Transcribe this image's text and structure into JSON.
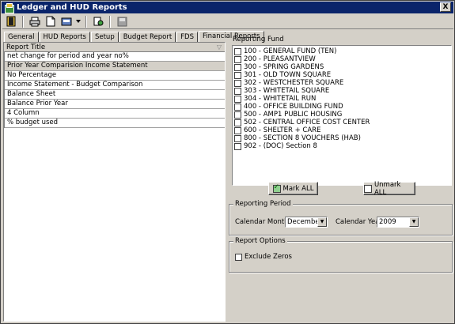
{
  "window": {
    "title": "Ledger and HUD Reports",
    "close_label": "X"
  },
  "toolbar": {
    "icons": [
      "exit-icon",
      "print-icon",
      "preview-icon",
      "export-icon",
      "dropdown-arrow-icon",
      "settings-icon",
      "save-icon"
    ]
  },
  "tabs": [
    {
      "label": "General",
      "active": false
    },
    {
      "label": "HUD Reports",
      "active": false
    },
    {
      "label": "Setup",
      "active": false
    },
    {
      "label": "Budget Report",
      "active": false
    },
    {
      "label": "FDS",
      "active": false
    },
    {
      "label": "Financial Reports",
      "active": true
    }
  ],
  "report_grid": {
    "header": "Report Title",
    "rows": [
      "net change for period and year no%",
      "Prior Year Comparision Income Statement",
      "No Percentage",
      "Income Statement - Budget Comparison",
      "Balance Sheet",
      "Balance Prior Year",
      "4 Column",
      "% budget used"
    ],
    "selected_index": 1
  },
  "reporting_fund": {
    "title": "Reporting Fund",
    "funds": [
      "100 - GENERAL FUND (TEN)",
      "200 - PLEASANTVIEW",
      "300 - SPRING GARDENS",
      "301 - OLD TOWN SQUARE",
      "302 - WESTCHESTER SQUARE",
      "303 - WHITETAIL SQUARE",
      "304 - WHITETAIL RUN",
      "400 - OFFICE BUILDING FUND",
      "500 - AMP1 PUBLIC HOUSING",
      "502 - CENTRAL OFFICE COST CENTER",
      "600 - SHELTER + CARE",
      "800 - SECTION 8 VOUCHERS (HAB)",
      "902 - (DOC) Section 8"
    ],
    "mark_all_label": "Mark ALL",
    "unmark_all_label": "Unmark ALL"
  },
  "reporting_period": {
    "title": "Reporting Period",
    "month_label": "Calendar Month",
    "month_value": "December",
    "year_label": "Calendar Year",
    "year_value": "2009"
  },
  "report_options": {
    "title": "Report Options",
    "exclude_zeros_label": "Exclude Zeros",
    "exclude_zeros_checked": false
  }
}
